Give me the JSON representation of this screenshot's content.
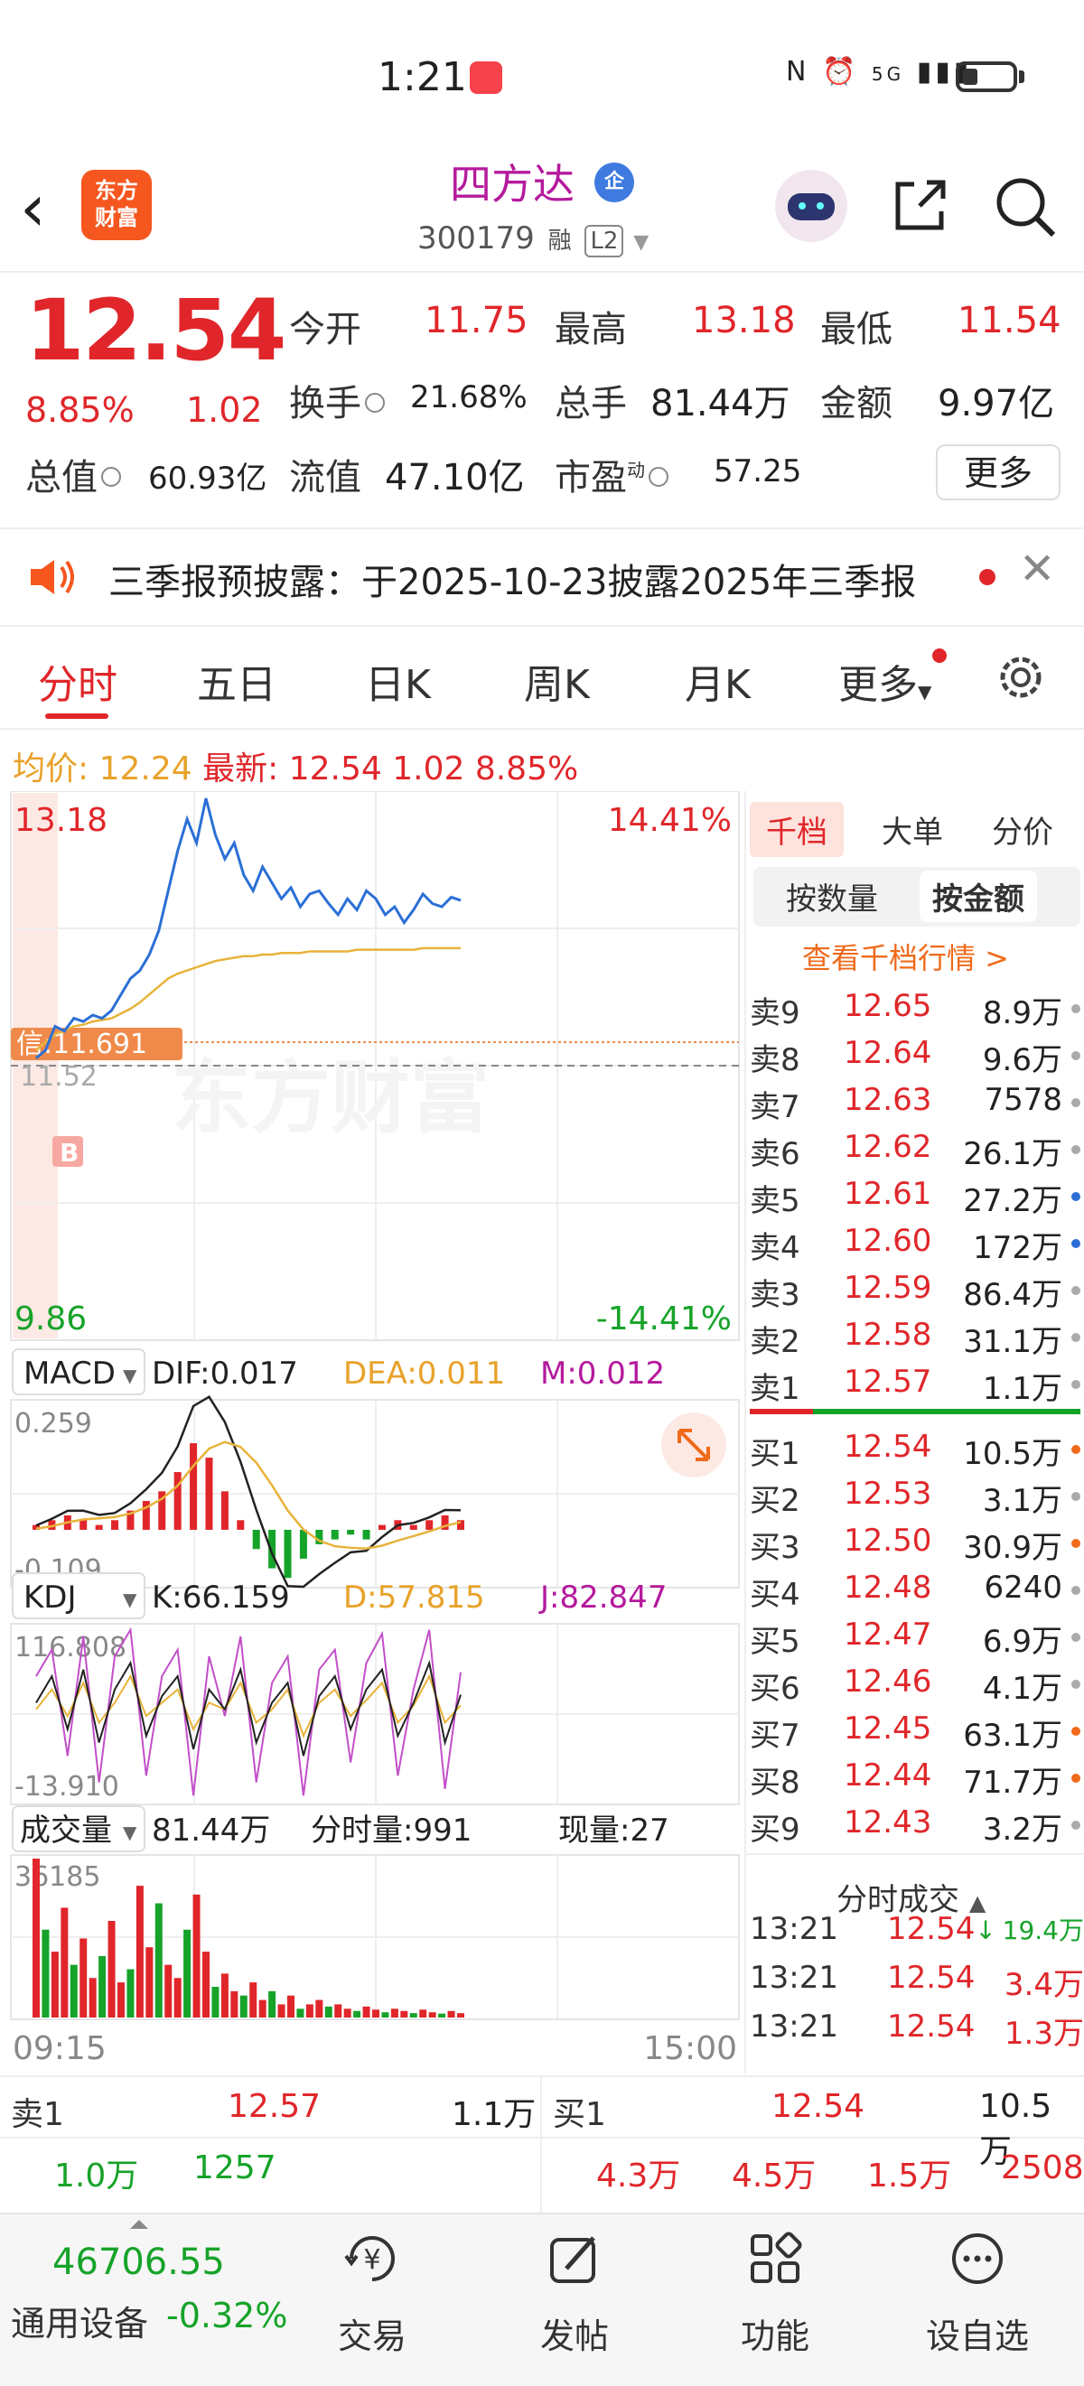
{
  "status_bar": {
    "time": "1:21",
    "network": "5G"
  },
  "header": {
    "logo_line1": "东方",
    "logo_line2": "财富",
    "stock_name": "四方达",
    "stock_badge": "企",
    "stock_code": "300179",
    "tag_margin": "融",
    "tag_level": "L2"
  },
  "quote": {
    "price": "12.54",
    "change_pct": "8.85%",
    "change_abs": "1.02",
    "open_label": "今开",
    "open": "11.75",
    "high_label": "最高",
    "high": "13.18",
    "low_label": "最低",
    "low": "11.54",
    "turnover_label": "换手",
    "turnover": "21.68%",
    "volume_label": "总手",
    "volume": "81.44万",
    "amount_label": "金额",
    "amount": "9.97亿",
    "mktcap_label": "总值",
    "mktcap": "60.93亿",
    "float_label": "流值",
    "float": "47.10亿",
    "pe_label": "市盈",
    "pe_sup": "动",
    "pe": "57.25",
    "more_button": "更多"
  },
  "notice": {
    "text": "三季报预披露：于2025-10-23披露2025年三季报"
  },
  "tabs": [
    "分时",
    "五日",
    "日K",
    "周K",
    "月K",
    "更多"
  ],
  "avg_row": {
    "avg_label": "均价:",
    "avg": "12.24",
    "latest_label": "最新:",
    "latest": "12.54",
    "chg": "1.02",
    "pct": "8.85%"
  },
  "chart_data": [
    {
      "type": "line",
      "name": "intraday",
      "y_top": "13.18",
      "y_bottom": "9.86",
      "pct_top": "14.41%",
      "pct_bottom": "-14.41%",
      "credit_label": "信:11.691",
      "pre_close_label": "11.52",
      "buy_marker": "B",
      "watermark": "东方财富",
      "x_start": "09:15",
      "x_end": "15:00",
      "price": [
        11.55,
        11.6,
        11.75,
        11.72,
        11.8,
        11.78,
        11.82,
        11.8,
        11.85,
        11.95,
        12.05,
        12.1,
        12.2,
        12.35,
        12.6,
        12.85,
        13.05,
        12.9,
        13.18,
        12.95,
        12.8,
        12.9,
        12.7,
        12.6,
        12.75,
        12.65,
        12.55,
        12.62,
        12.5,
        12.58,
        12.6,
        12.52,
        12.45,
        12.55,
        12.48,
        12.6,
        12.55,
        12.45,
        12.5,
        12.4,
        12.48,
        12.58,
        12.52,
        12.5,
        12.56,
        12.54
      ],
      "avg": [
        11.6,
        11.65,
        11.7,
        11.72,
        11.75,
        11.76,
        11.78,
        11.79,
        11.8,
        11.83,
        11.86,
        11.9,
        11.95,
        12.0,
        12.05,
        12.08,
        12.1,
        12.12,
        12.14,
        12.16,
        12.17,
        12.18,
        12.19,
        12.19,
        12.2,
        12.2,
        12.21,
        12.21,
        12.21,
        12.22,
        12.22,
        12.22,
        12.22,
        12.22,
        12.23,
        12.23,
        12.23,
        12.23,
        12.23,
        12.23,
        12.23,
        12.24,
        12.24,
        12.24,
        12.24,
        12.24
      ]
    },
    {
      "type": "bar",
      "name": "MACD",
      "selector": "MACD",
      "dif_label": "DIF:0.017",
      "dea_label": "DEA:0.011",
      "m_label": "M:0.012",
      "y_top": "0.259",
      "y_bottom": "-0.109",
      "values": [
        0.01,
        0.02,
        0.03,
        0.02,
        0.01,
        0.02,
        0.04,
        0.06,
        0.08,
        0.12,
        0.18,
        0.15,
        0.08,
        0.02,
        -0.04,
        -0.08,
        -0.1,
        -0.06,
        -0.03,
        -0.02,
        -0.01,
        -0.02,
        0.01,
        0.02,
        0.01,
        0.02,
        0.03,
        0.02
      ]
    },
    {
      "type": "line",
      "name": "KDJ",
      "selector": "KDJ",
      "k_label": "K:66.159",
      "d_label": "D:57.815",
      "j_label": "J:82.847",
      "y_top": "116.808",
      "y_bottom": "-13.910",
      "k": [
        60,
        80,
        40,
        85,
        30,
        70,
        90,
        35,
        65,
        80,
        25,
        70,
        55,
        85,
        30,
        60,
        75,
        20,
        65,
        80,
        40,
        70,
        85,
        35,
        60,
        90,
        30,
        66
      ],
      "d": [
        55,
        70,
        50,
        75,
        45,
        60,
        80,
        50,
        60,
        70,
        40,
        60,
        55,
        75,
        45,
        55,
        70,
        35,
        60,
        70,
        50,
        62,
        75,
        45,
        58,
        80,
        45,
        58
      ],
      "j": [
        80,
        100,
        20,
        110,
        0,
        95,
        115,
        5,
        80,
        100,
        -10,
        95,
        50,
        110,
        0,
        75,
        95,
        -10,
        85,
        100,
        15,
        90,
        112,
        5,
        70,
        115,
        -5,
        83
      ]
    },
    {
      "type": "bar",
      "name": "volume",
      "selector": "成交量",
      "total_label": "81.44万",
      "period_label": "分时量:991",
      "now_label": "现量:27",
      "y_top": "36185",
      "values": [
        36185,
        20000,
        15000,
        25000,
        12000,
        18000,
        9000,
        14000,
        22000,
        8000,
        11000,
        30000,
        16000,
        26000,
        12000,
        9000,
        20000,
        28000,
        15000,
        7000,
        10000,
        6000,
        5000,
        8000,
        4000,
        6000,
        3000,
        5000,
        2000,
        3000,
        4000,
        2500,
        3000,
        2000,
        1500,
        2500,
        1800,
        1200,
        2000,
        1500,
        1000,
        1800,
        1200,
        900,
        1500,
        991
      ]
    }
  ],
  "order_book": {
    "tabs": [
      "千档",
      "大单",
      "分价"
    ],
    "seg": [
      "按数量",
      "按金额"
    ],
    "link": "查看千档行情 >",
    "asks": [
      {
        "label": "卖9",
        "price": "12.65",
        "vol": "8.9万",
        "dot": "#aaaaaa"
      },
      {
        "label": "卖8",
        "price": "12.64",
        "vol": "9.6万",
        "dot": "#aaaaaa"
      },
      {
        "label": "卖7",
        "price": "12.63",
        "vol": "7578",
        "dot": "#aaaaaa"
      },
      {
        "label": "卖6",
        "price": "12.62",
        "vol": "26.1万",
        "dot": "#aaaaaa"
      },
      {
        "label": "卖5",
        "price": "12.61",
        "vol": "27.2万",
        "dot": "#2b6fd6"
      },
      {
        "label": "卖4",
        "price": "12.60",
        "vol": "172万",
        "dot": "#2b6fd6"
      },
      {
        "label": "卖3",
        "price": "12.59",
        "vol": "86.4万",
        "dot": "#aaaaaa"
      },
      {
        "label": "卖2",
        "price": "12.58",
        "vol": "31.1万",
        "dot": "#aaaaaa"
      },
      {
        "label": "卖1",
        "price": "12.57",
        "vol": "1.1万",
        "dot": "#aaaaaa"
      }
    ],
    "bids": [
      {
        "label": "买1",
        "price": "12.54",
        "vol": "10.5万",
        "dot": "#f06a1a"
      },
      {
        "label": "买2",
        "price": "12.53",
        "vol": "3.1万",
        "dot": "#aaaaaa"
      },
      {
        "label": "买3",
        "price": "12.50",
        "vol": "30.9万",
        "dot": "#f06a1a"
      },
      {
        "label": "买4",
        "price": "12.48",
        "vol": "6240",
        "dot": "#aaaaaa"
      },
      {
        "label": "买5",
        "price": "12.47",
        "vol": "6.9万",
        "dot": "#aaaaaa"
      },
      {
        "label": "买6",
        "price": "12.46",
        "vol": "4.1万",
        "dot": "#aaaaaa"
      },
      {
        "label": "买7",
        "price": "12.45",
        "vol": "63.1万",
        "dot": "#f06a1a"
      },
      {
        "label": "买8",
        "price": "12.44",
        "vol": "71.7万",
        "dot": "#f06a1a"
      },
      {
        "label": "买9",
        "price": "12.43",
        "vol": "3.2万",
        "dot": "#aaaaaa"
      }
    ],
    "ticks_header": "分时成交",
    "ticks": [
      {
        "time": "13:21",
        "price": "12.54",
        "vol": "19.4万",
        "dir": "↓",
        "color": "#16a329"
      },
      {
        "time": "13:21",
        "price": "12.54",
        "vol": "3.4万",
        "dir": "",
        "color": "#e0262a"
      },
      {
        "time": "13:21",
        "price": "12.54",
        "vol": "1.3万",
        "dir": "",
        "color": "#e0262a"
      }
    ]
  },
  "level_bar": {
    "ask_label": "卖1",
    "ask_price": "12.57",
    "ask_vol": "1.1万",
    "bid_label": "买1",
    "bid_price": "12.54",
    "bid_vol": "10.5万",
    "ask_q1": "1.0万",
    "ask_q2": "1257",
    "bid_q1": "4.3万",
    "bid_q2": "4.5万",
    "bid_q3": "1.5万",
    "bid_q4": "2508"
  },
  "bottom_nav": {
    "index_value": "46706.55",
    "index_name": "通用设备",
    "index_change": "-0.32%",
    "items": [
      "交易",
      "发帖",
      "功能",
      "设自选"
    ]
  },
  "colors": {
    "up": "#e0262a",
    "down": "#16a329",
    "accent": "#f06a1a",
    "price_line": "#2b6fd6",
    "avg_line": "#e8b33a"
  }
}
